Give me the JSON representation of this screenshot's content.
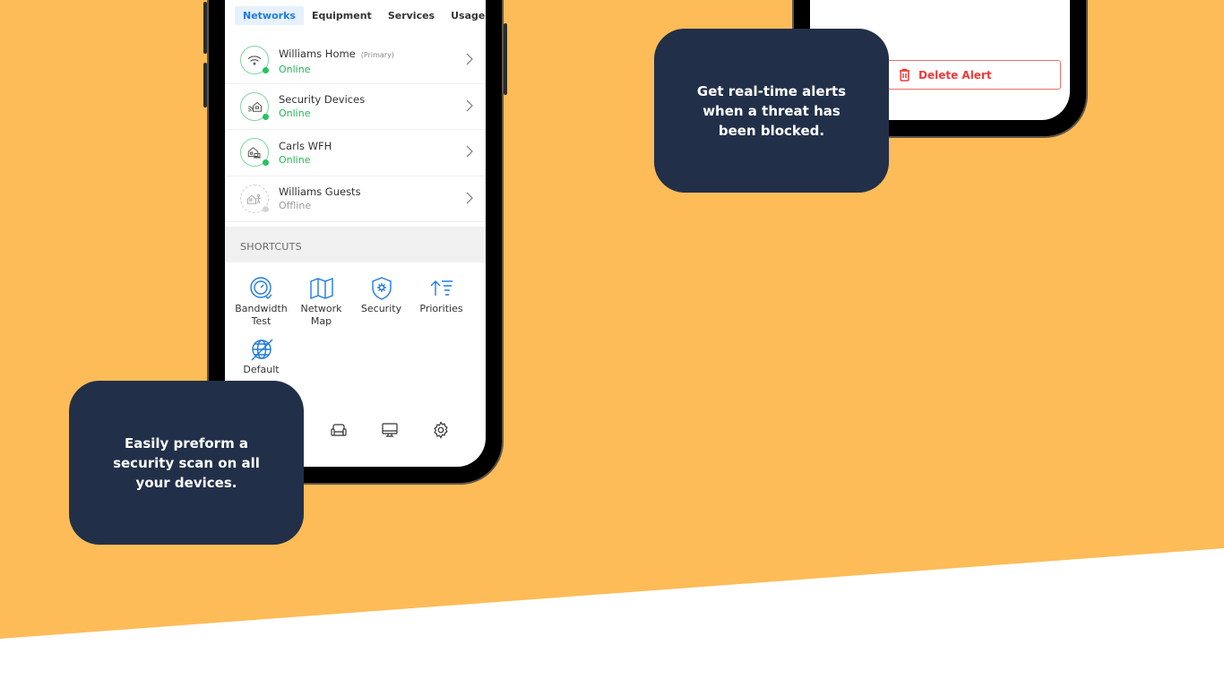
{
  "background": {
    "color": "#FDBC58",
    "wedge_color": "#FFFFFF"
  },
  "phone_network": {
    "tabs": [
      {
        "label": "Networks",
        "active": true
      },
      {
        "label": "Equipment",
        "active": false
      },
      {
        "label": "Services",
        "active": false
      },
      {
        "label": "Usage",
        "active": false
      }
    ],
    "networks": [
      {
        "name": "Williams Home",
        "tag": "(Primary)",
        "status": "Online",
        "online": true,
        "icon": "wifi-icon"
      },
      {
        "name": "Security Devices",
        "tag": "",
        "status": "Online",
        "online": true,
        "icon": "security-home-icon"
      },
      {
        "name": "Carls WFH",
        "tag": "",
        "status": "Online",
        "online": true,
        "icon": "home-office-icon"
      },
      {
        "name": "Williams Guests",
        "tag": "",
        "status": "Offline",
        "online": false,
        "icon": "guest-home-icon"
      }
    ],
    "shortcuts_header": "SHORTCUTS",
    "shortcuts": [
      {
        "label": "Bandwidth Test",
        "icon": "speedometer-icon"
      },
      {
        "label": "Network Map",
        "icon": "map-icon"
      },
      {
        "label": "Security",
        "icon": "shield-icon"
      },
      {
        "label": "Priorities",
        "icon": "priorities-icon"
      },
      {
        "label": "Default",
        "icon": "globe-off-icon"
      }
    ],
    "bottom_nav": [
      "users-icon",
      "couch-icon",
      "monitor-icon",
      "gear-icon"
    ],
    "colors": {
      "accent": "#1E7BE2",
      "online": "#1DB954",
      "offline": "#999999"
    }
  },
  "phone_alert": {
    "delete_button": {
      "label": "Delete Alert",
      "color": "#EE3B3B"
    }
  },
  "callouts": {
    "alerts": "Get real-time alerts when a threat has been blocked.",
    "scan": "Easily preform a security scan on all your devices."
  }
}
